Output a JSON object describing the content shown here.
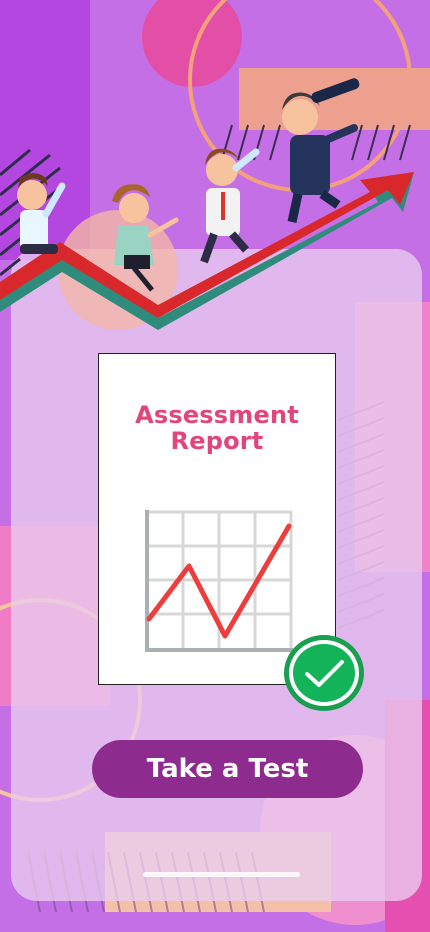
{
  "card": {
    "title_line1": "Assessment",
    "title_line2": "Report"
  },
  "cta": {
    "label": "Take a Test"
  },
  "icons": {
    "badge": "check-circle-icon",
    "chart": "line-chart-icon"
  },
  "colors": {
    "background": "#c56fe6",
    "accent_pink": "#e2457c",
    "button": "#8e2b8f",
    "check_green": "#13b35a"
  }
}
